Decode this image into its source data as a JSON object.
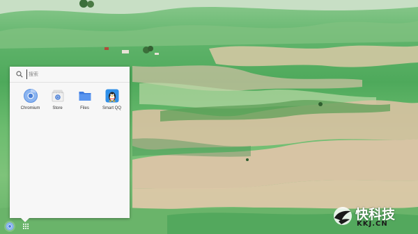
{
  "search": {
    "placeholder": "搜索"
  },
  "apps": [
    {
      "label": "Chromium",
      "icon": "chromium-icon"
    },
    {
      "label": "Store",
      "icon": "store-icon"
    },
    {
      "label": "Files",
      "icon": "folder-icon"
    },
    {
      "label": "Smart QQ",
      "icon": "qq-penguin-icon"
    }
  ],
  "shelf": {
    "launcher_icon": "chromium-icon",
    "app_list_icon": "grid-icon"
  },
  "watermark": {
    "title": "快科技",
    "subtitle": "KKJ.CN"
  },
  "colors": {
    "launcher_bg": "#f7f7f7",
    "folder_blue": "#3d7be0",
    "chromium_blue": "#4a7fd6"
  }
}
